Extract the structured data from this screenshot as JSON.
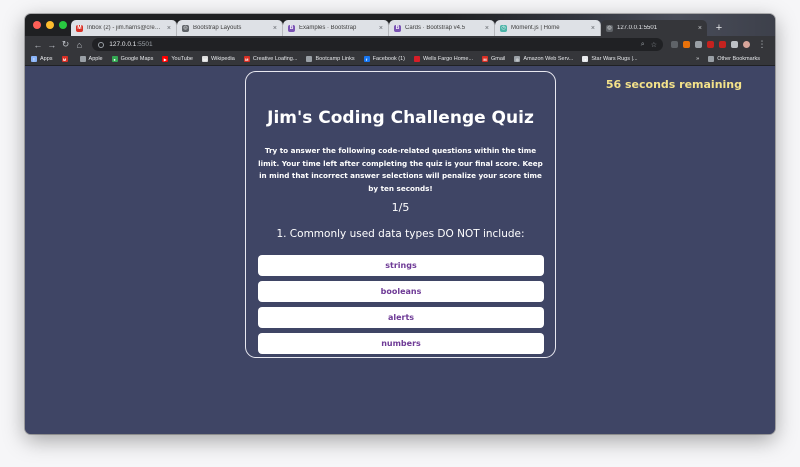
{
  "browser": {
    "tabs": [
      {
        "icon": "gmail-icon",
        "title": "Inbox (2) - jim.harris@creativ",
        "color": "#d93025",
        "glyph": "M"
      },
      {
        "icon": "globe-icon",
        "title": "Bootstrap Layouts",
        "color": "#5f6368",
        "glyph": "◎"
      },
      {
        "icon": "bootstrap-icon",
        "title": "Examples · Bootstrap",
        "color": "#7952b3",
        "glyph": "B"
      },
      {
        "icon": "bootstrap-icon",
        "title": "Cards · Bootstrap v4.5",
        "color": "#7952b3",
        "glyph": "B"
      },
      {
        "icon": "momentjs-icon",
        "title": "Moment.js | Home",
        "color": "#4bb3a7",
        "glyph": "◷"
      },
      {
        "icon": "globe-icon",
        "title": "127.0.0.1:5501",
        "color": "#5f6368",
        "glyph": "◎",
        "active": true
      }
    ],
    "url_host": "127.0.0.1",
    "url_port": ":5501",
    "bookmarks": [
      {
        "label": "Apps",
        "icon": "apps-icon",
        "color": "#8ab4f8",
        "glyph": "⋮"
      },
      {
        "label": "",
        "icon": "gmail-icon",
        "color": "#d93025",
        "glyph": "M"
      },
      {
        "label": "Apple",
        "icon": "apple-icon",
        "color": "#9aa0a6",
        "glyph": ""
      },
      {
        "label": "Google Maps",
        "icon": "maps-icon",
        "color": "#34a853",
        "glyph": "●"
      },
      {
        "label": "YouTube",
        "icon": "youtube-icon",
        "color": "#ff0000",
        "glyph": "▶"
      },
      {
        "label": "Wikipedia",
        "icon": "wikipedia-icon",
        "color": "#dddddd",
        "glyph": "W"
      },
      {
        "label": "Creative Loafing...",
        "icon": "gmail-icon",
        "color": "#d93025",
        "glyph": "M"
      },
      {
        "label": "Bootcamp Links",
        "icon": "folder-icon",
        "color": "#9aa0a6",
        "glyph": ""
      },
      {
        "label": "Facebook (1)",
        "icon": "facebook-icon",
        "color": "#1877f2",
        "glyph": "f"
      },
      {
        "label": "Wells Fargo Home...",
        "icon": "wellsfargo-icon",
        "color": "#d71e28",
        "glyph": ""
      },
      {
        "label": "Gmail",
        "icon": "gmail-icon",
        "color": "#d93025",
        "glyph": "M"
      },
      {
        "label": "Amazon Web Serv...",
        "icon": "globe-icon",
        "color": "#9aa0a6",
        "glyph": "◎"
      },
      {
        "label": "Star Wars Rugs |...",
        "icon": "globe-icon",
        "color": "#e8eaed",
        "glyph": "●"
      }
    ],
    "other_bookmarks": "Other Bookmarks"
  },
  "quiz": {
    "timer_text": "56 seconds remaining",
    "title": "Jim's Coding Challenge Quiz",
    "description": "Try to answer the following code-related questions within the time limit. Your time left after completing the quiz is your final score. Keep in mind that incorrect answer selections will penalize your score time by ten seconds!",
    "progress": "1/5",
    "question": "1. Commonly used data types DO NOT include:",
    "answers": [
      "strings",
      "booleans",
      "alerts",
      "numbers"
    ]
  },
  "colors": {
    "page_bg": "#3f4565",
    "timer": "#f4e28a",
    "answer_text": "#6e3a96"
  }
}
